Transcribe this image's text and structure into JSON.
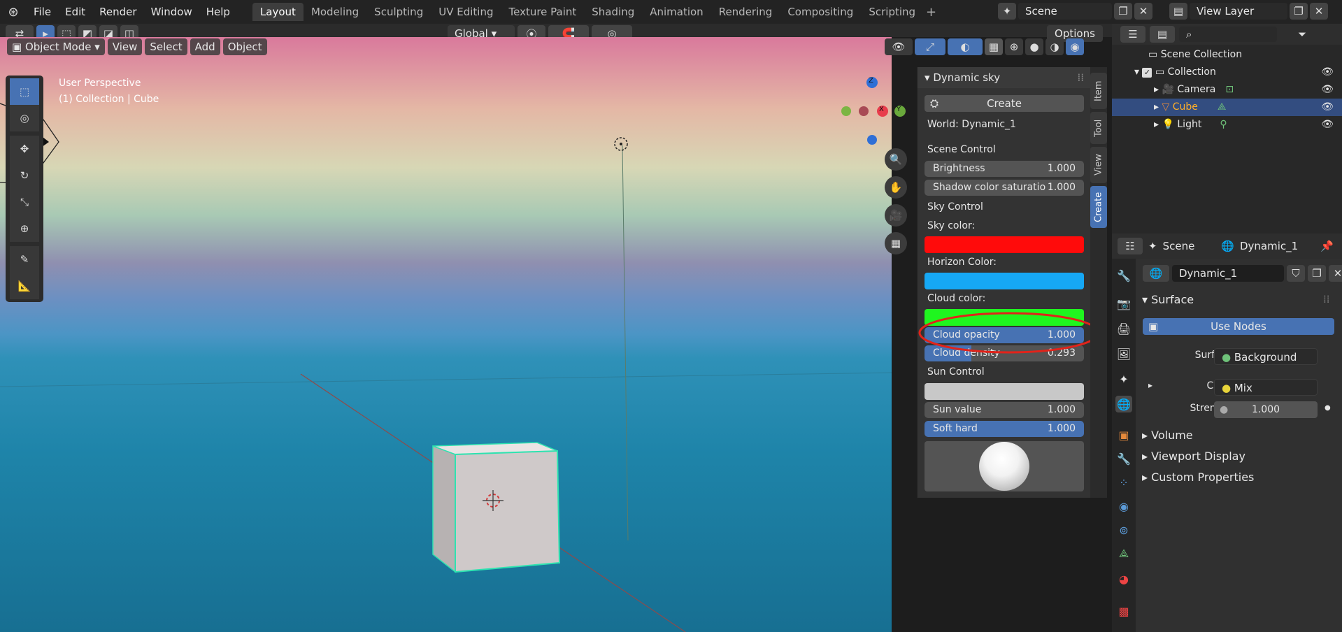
{
  "menu": [
    "File",
    "Edit",
    "Render",
    "Window",
    "Help"
  ],
  "workspaces": [
    "Layout",
    "Modeling",
    "Sculpting",
    "UV Editing",
    "Texture Paint",
    "Shading",
    "Animation",
    "Rendering",
    "Compositing",
    "Scripting"
  ],
  "scene_field": "Scene",
  "viewlayer_field": "View Layer",
  "toolbar": {
    "transform": "Global",
    "options": "Options"
  },
  "viewport_header": {
    "mode": "Object Mode",
    "view": "View",
    "select": "Select",
    "add": "Add",
    "object": "Object"
  },
  "viewport_info": {
    "perspective": "User Perspective",
    "collection": "(1) Collection | Cube"
  },
  "gizmo": {
    "z": "Z",
    "x": "X",
    "y": "Y"
  },
  "npanel": {
    "title": "Dynamic sky",
    "create": "Create",
    "world": "World: Dynamic_1",
    "scene_control": "Scene Control",
    "brightness_label": "Brightness",
    "brightness_value": "1.000",
    "shadow_label": "Shadow color saturatio",
    "shadow_value": "1.000",
    "sky_control": "Sky Control",
    "sky_color_label": "Sky color:",
    "horizon_color_label": "Horizon Color:",
    "cloud_color_label": "Cloud color:",
    "cloud_opacity_label": "Cloud opacity",
    "cloud_opacity_value": "1.000",
    "cloud_density_label": "Cloud density",
    "cloud_density_value": "0.293",
    "cloud_density_fraction": 0.293,
    "sun_control": "Sun Control",
    "sun_value_label": "Sun value",
    "sun_value_value": "1.000",
    "soft_hard_label": "Soft hard",
    "soft_hard_value": "1.000",
    "tabs": [
      "Item",
      "Tool",
      "View",
      "Create"
    ],
    "colors": {
      "sky": "#ff0b0b",
      "horizon": "#16a8f5",
      "cloud": "#1ff51f",
      "sun": "#c8c8c8"
    }
  },
  "outliner": {
    "root": "Scene Collection",
    "collection": "Collection",
    "items": [
      "Camera",
      "Cube",
      "Light"
    ]
  },
  "properties": {
    "scene": "Scene",
    "world": "Dynamic_1",
    "world_field": "Dynamic_1",
    "surface": "Surface",
    "use_nodes": "Use Nodes",
    "surface_label": "Surface",
    "surface_value": "Background",
    "color_label": "Color",
    "color_value": "Mix",
    "strength_label": "Strength",
    "strength_value": "1.000",
    "panels": [
      "Volume",
      "Viewport Display",
      "Custom Properties"
    ]
  }
}
